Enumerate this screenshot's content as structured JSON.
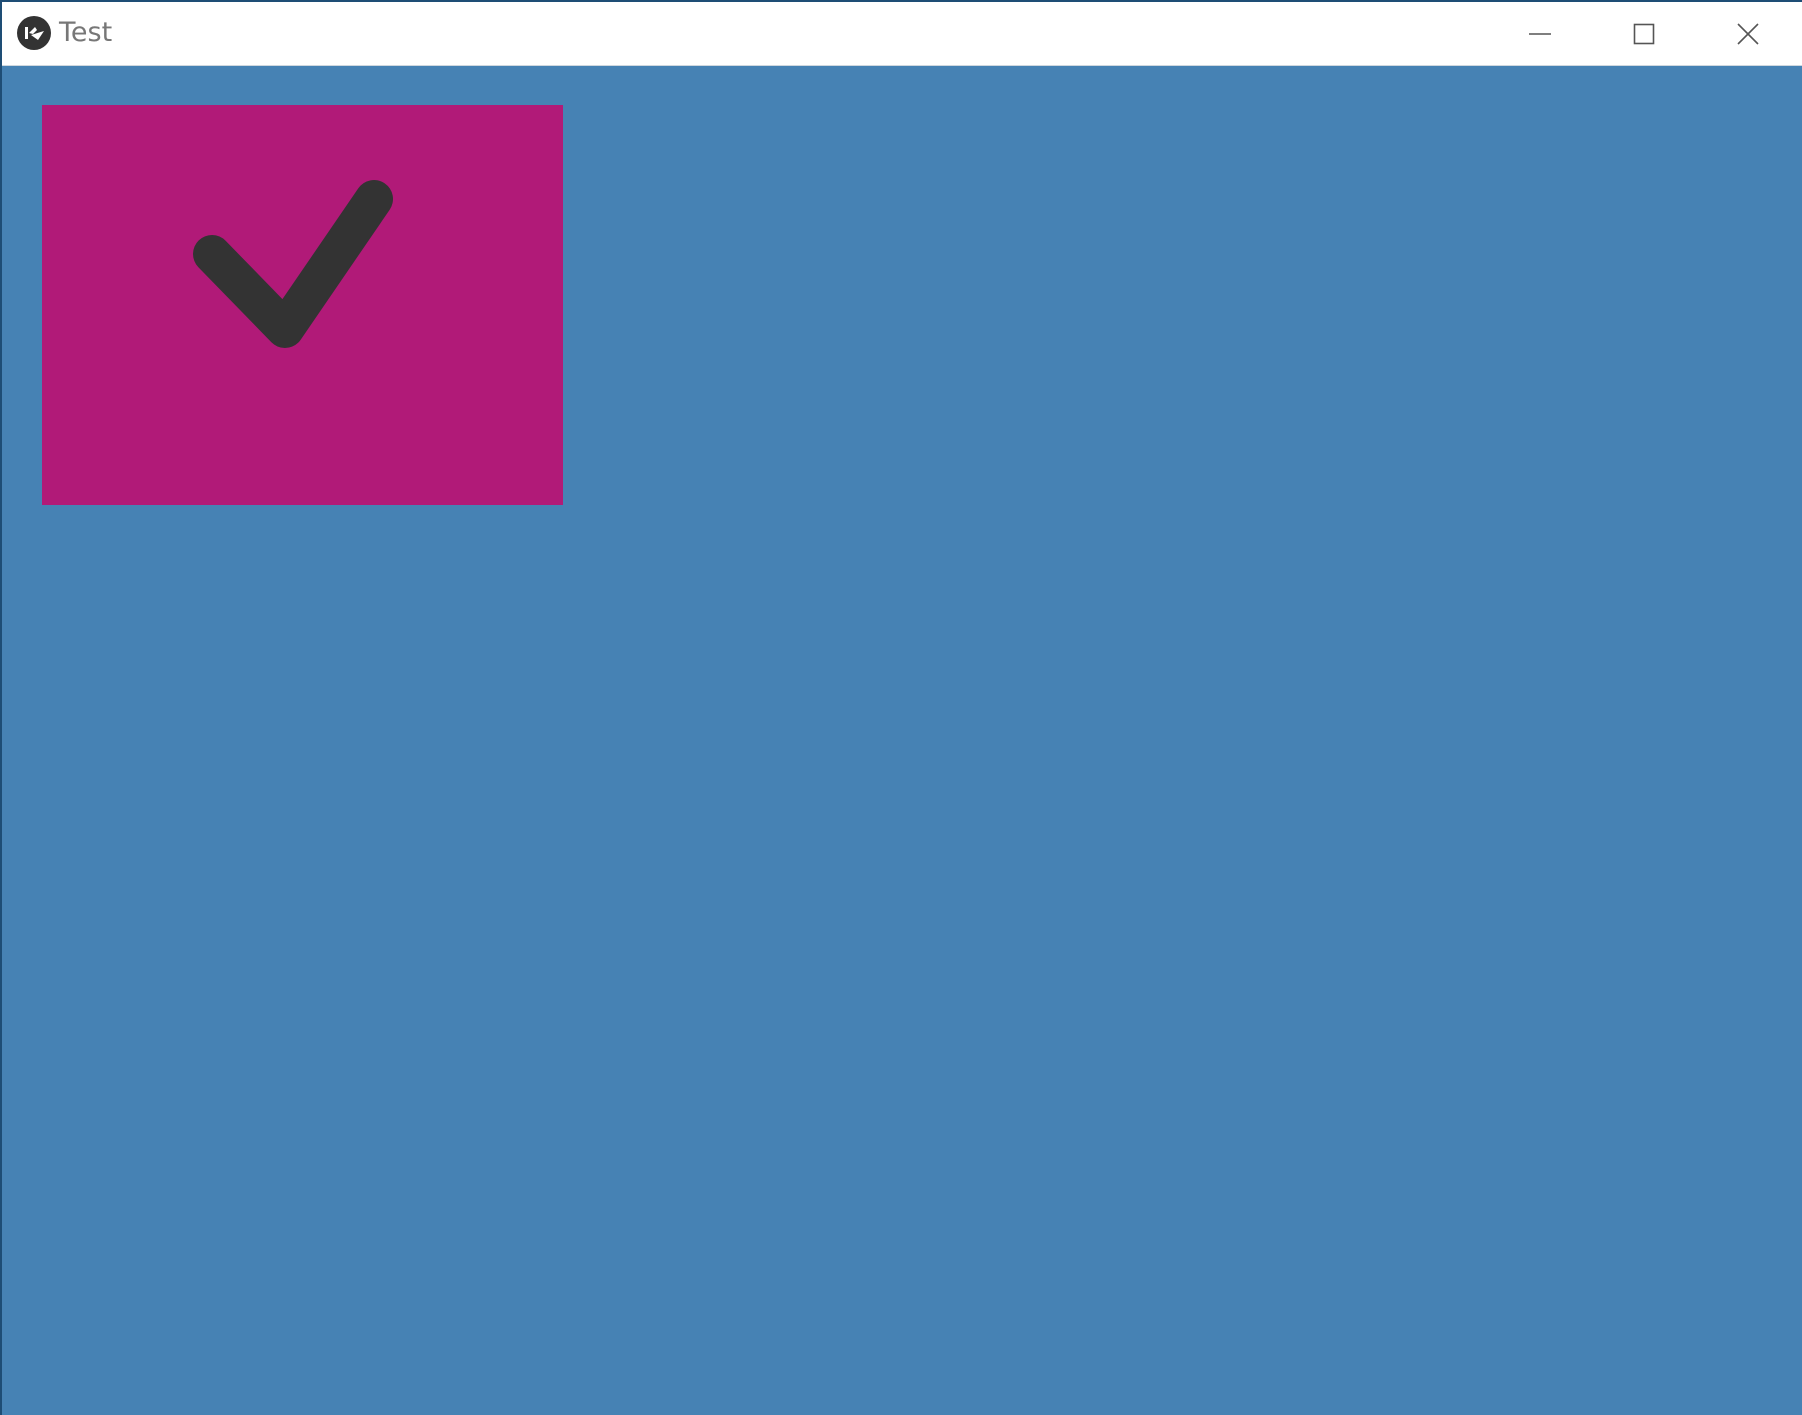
{
  "window": {
    "title": "Test",
    "controls": {
      "minimize_icon": "minimize-icon",
      "maximize_icon": "maximize-icon",
      "close_icon": "close-icon"
    }
  },
  "main": {
    "background_color": "#4682b4",
    "tile": {
      "color": "#b11a78",
      "icon": "checkmark-icon",
      "icon_color": "#333333"
    }
  }
}
